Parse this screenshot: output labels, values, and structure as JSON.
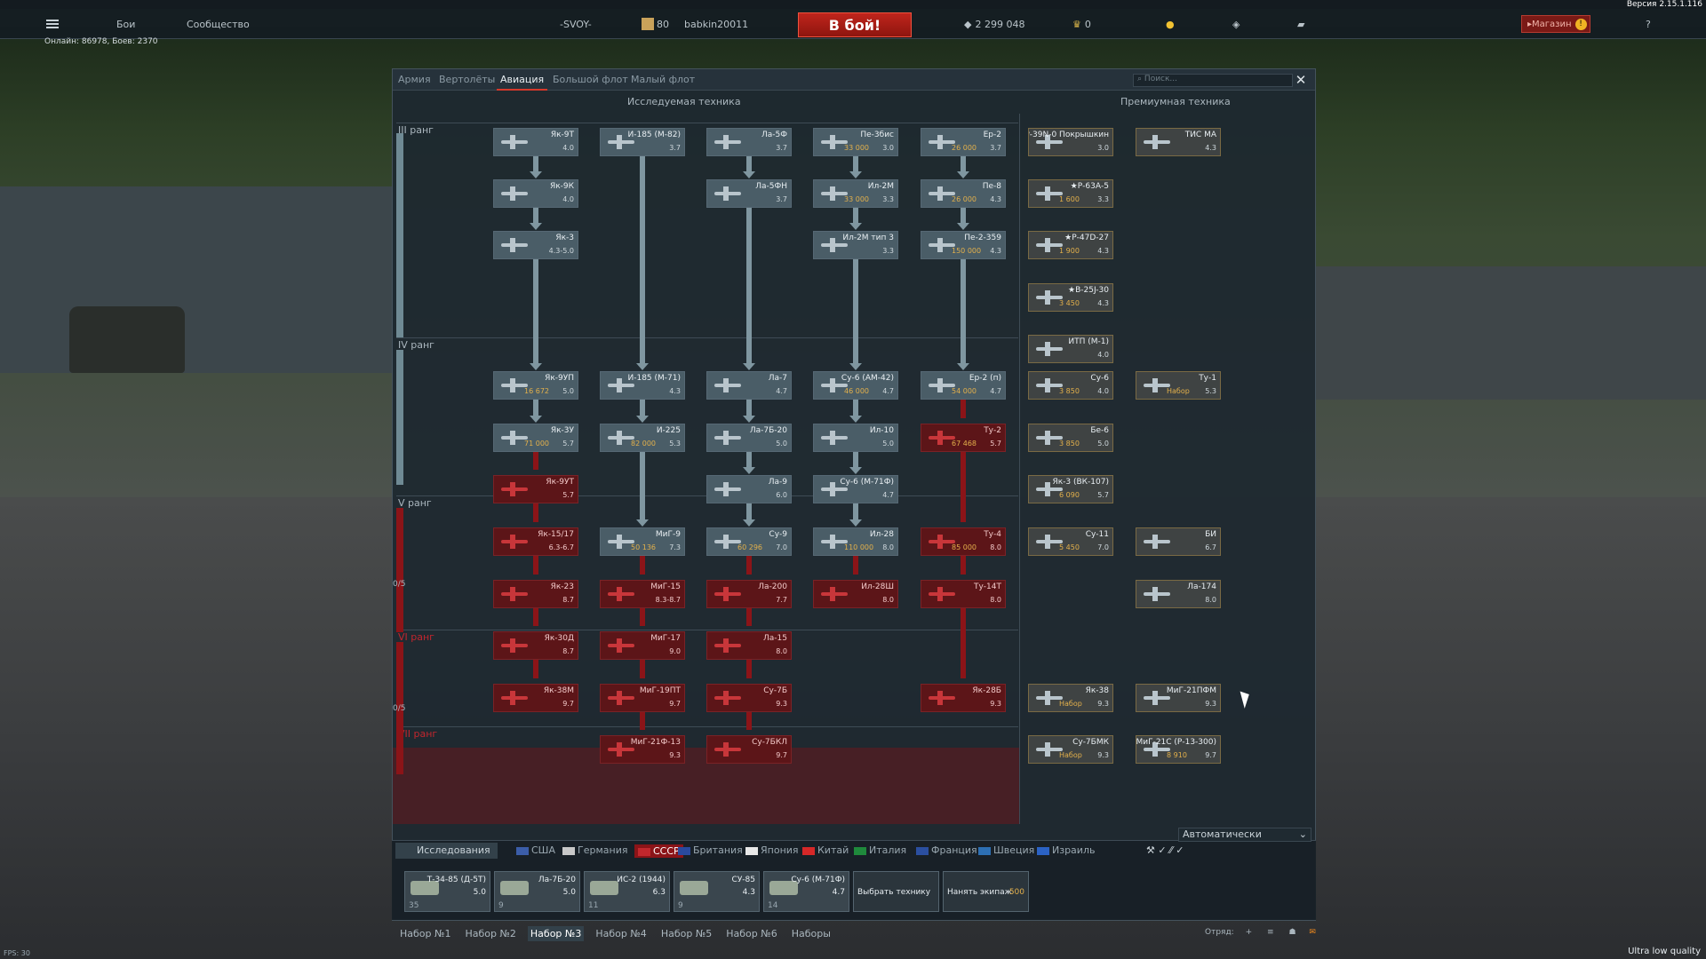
{
  "version": "Версия 2.15.1.116",
  "topbar": {
    "battles": "Бои",
    "community": "Сообщество",
    "squad_tag": "-SVOY-",
    "level": "80",
    "nickname": "babkin20011",
    "fight": "В бой!",
    "silver": "2 299 048",
    "gold": "0",
    "shop": "Магазин"
  },
  "online": "Онлайн: 86978, Боев: 2370",
  "tabs": [
    "Армия",
    "Вертолёты",
    "Авиация",
    "Большой флот",
    "Малый флот"
  ],
  "active_tab": "Авиация",
  "search_placeholder": "Поиск...",
  "researched_header": "Исследуемая техника",
  "premium_header": "Премиумная техника",
  "ranks": [
    "III ранг",
    "IV ранг",
    "V ранг",
    "VI ранг",
    "VII ранг"
  ],
  "rank_counts": [
    "0/5",
    "0/5"
  ],
  "columns": [
    [
      {
        "n": "Як-9Т",
        "b": "4.0"
      },
      {
        "n": "Як-9К",
        "b": "4.0"
      },
      {
        "n": "Як-3",
        "b": "4.3-5.0"
      },
      {
        "n": "Як-9УП",
        "b": "5.0",
        "c": "16 672"
      },
      {
        "n": "Як-3У",
        "b": "5.7",
        "c": "71 000"
      },
      {
        "n": "Як-9УТ",
        "b": "5.7"
      },
      {
        "n": "Як-15/17",
        "b": "6.3-6.7"
      },
      {
        "n": "Як-23",
        "b": "8.7"
      },
      {
        "n": "Як-30Д",
        "b": "8.7"
      },
      {
        "n": "Як-38М",
        "b": "9.7"
      }
    ],
    [
      {
        "n": "И-185 (М-82)",
        "b": "3.7"
      },
      {
        "n": "И-185 (М-71)",
        "b": "4.3"
      },
      {
        "n": "И-225",
        "b": "5.3",
        "c": "82 000"
      },
      {
        "n": "МиГ-9",
        "b": "7.3",
        "c": "50 136"
      },
      {
        "n": "МиГ-15",
        "b": "8.3-8.7"
      },
      {
        "n": "МиГ-17",
        "b": "9.0"
      },
      {
        "n": "МиГ-19ПТ",
        "b": "9.7"
      },
      {
        "n": "МиГ-21Ф-13",
        "b": "9.3"
      }
    ],
    [
      {
        "n": "Ла-5Ф",
        "b": "3.7"
      },
      {
        "n": "Ла-5ФН",
        "b": "3.7"
      },
      {
        "n": "Ла-7",
        "b": "4.7"
      },
      {
        "n": "Ла-7Б-20",
        "b": "5.0"
      },
      {
        "n": "Ла-9",
        "b": "6.0"
      },
      {
        "n": "Су-9",
        "b": "7.0",
        "c": "60 296"
      },
      {
        "n": "Ла-200",
        "b": "7.7"
      },
      {
        "n": "Ла-15",
        "b": "8.0"
      },
      {
        "n": "Су-7Б",
        "b": "9.3"
      },
      {
        "n": "Су-7БКЛ",
        "b": "9.7"
      }
    ],
    [
      {
        "n": "Пе-3бис",
        "b": "3.0",
        "c": "33 000"
      },
      {
        "n": "Ил-2М",
        "b": "3.3",
        "c": "33 000"
      },
      {
        "n": "Ил-2М тип 3",
        "b": "3.3"
      },
      {
        "n": "Су-6 (АМ-42)",
        "b": "4.7",
        "c": "46 000"
      },
      {
        "n": "Ил-10",
        "b": "5.0"
      },
      {
        "n": "Су-6 (М-71Ф)",
        "b": "4.7"
      },
      {
        "n": "Ил-28",
        "b": "8.0",
        "c": "110 000"
      },
      {
        "n": "Ил-28Ш",
        "b": "8.0"
      }
    ],
    [
      {
        "n": "Ер-2",
        "b": "3.7",
        "c": "26 000"
      },
      {
        "n": "Пе-8",
        "b": "4.3",
        "c": "26 000"
      },
      {
        "n": "Пе-2-359",
        "b": "4.3",
        "c": "150 000"
      },
      {
        "n": "Ер-2 (п)",
        "b": "4.7",
        "c": "54 000"
      },
      {
        "n": "Ту-2",
        "b": "5.7",
        "c": "67 468"
      },
      {
        "n": "Ту-4",
        "b": "8.0",
        "c": "85 000"
      },
      {
        "n": "Ту-14Т",
        "b": "8.0"
      },
      {
        "n": "Як-28Б",
        "b": "9.3"
      }
    ]
  ],
  "premium": [
    {
      "n": "★Р-39N-0 Покрышкин",
      "b": "3.0"
    },
    {
      "n": "ТИС МА",
      "b": "4.3"
    },
    {
      "n": "★Р-63А-5",
      "b": "3.3",
      "c": "1 600"
    },
    {
      "n": "★Р-47D-27",
      "b": "4.3",
      "c": "1 900"
    },
    {
      "n": "★В-25J-30",
      "b": "4.3",
      "c": "3 450"
    },
    {
      "n": "ИТП (М-1)",
      "b": "4.0"
    },
    {
      "n": "Су-6",
      "b": "4.0",
      "c": "3 850"
    },
    {
      "n": "Ту-1",
      "b": "5.3",
      "c": "Набор"
    },
    {
      "n": "Бе-6",
      "b": "5.0",
      "c": "3 850"
    },
    {
      "n": "Як-3 (ВК-107)",
      "b": "5.7",
      "c": "6 090"
    },
    {
      "n": "Су-11",
      "b": "7.0",
      "c": "5 450"
    },
    {
      "n": "БИ",
      "b": "6.7"
    },
    {
      "n": "Ла-174",
      "b": "8.0"
    },
    {
      "n": "Як-38",
      "b": "9.3",
      "c": "Набор"
    },
    {
      "n": "МиГ-21ПФМ",
      "b": "9.3"
    },
    {
      "n": "Су-7БМК",
      "b": "9.3",
      "c": "Набор"
    },
    {
      "n": "МиГ-21С (Р-13-300)",
      "b": "9.7",
      "c": "8 910"
    }
  ],
  "research_label": "Исследования",
  "auto": "Автоматически",
  "nations": [
    "США",
    "Германия",
    "СССР",
    "Британия",
    "Япония",
    "Китай",
    "Италия",
    "Франция",
    "Швеция",
    "Израиль"
  ],
  "active_nation": "СССР",
  "slots": [
    {
      "n": "Т-34-85 (Д-5Т)",
      "b": "5.0",
      "cnt": "35"
    },
    {
      "n": "Ла-7Б-20",
      "b": "5.0",
      "cnt": "9"
    },
    {
      "n": "ИС-2 (1944)",
      "b": "6.3",
      "cnt": "11"
    },
    {
      "n": "СУ-85",
      "b": "4.3",
      "cnt": "9"
    },
    {
      "n": "Су-6 (М-71Ф)",
      "b": "4.7",
      "cnt": "14"
    }
  ],
  "actions": [
    "Выбрать технику",
    "Нанять экипаж"
  ],
  "crew_cost": "500",
  "presets": [
    "Набор №1",
    "Набор №2",
    "Набор №3",
    "Набор №4",
    "Набор №5",
    "Набор №6",
    "Наборы"
  ],
  "active_preset": "Набор №3",
  "squad_label": "Отряд:",
  "fps": "FPS: 30",
  "quality": "Ultra low quality"
}
